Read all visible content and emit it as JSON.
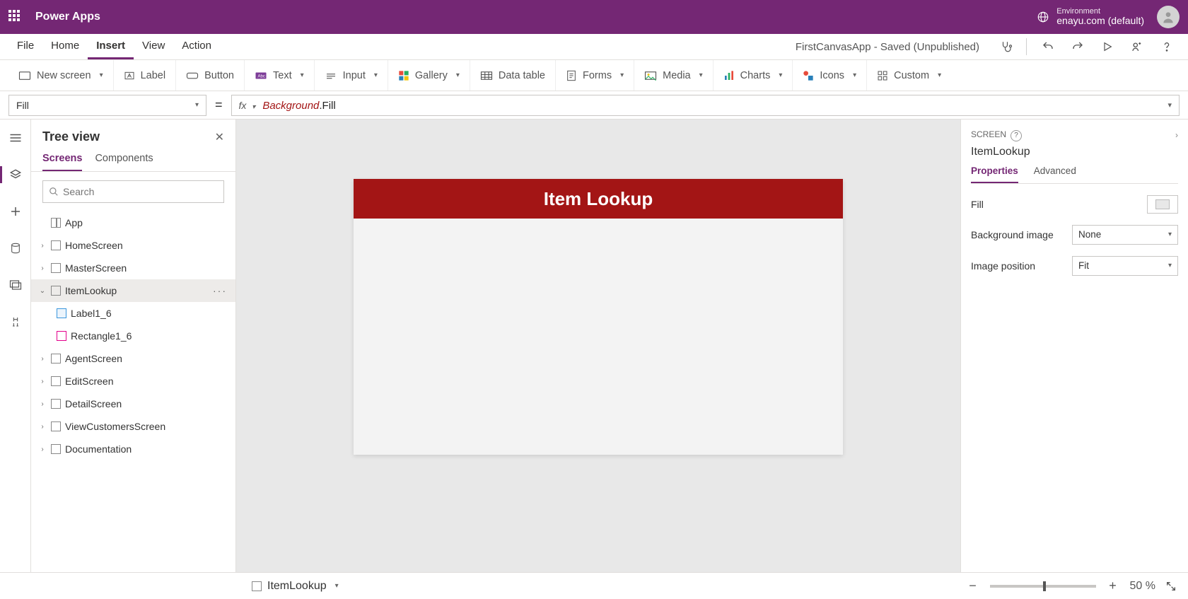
{
  "header": {
    "app_title": "Power Apps",
    "env_label": "Environment",
    "env_name": "enayu.com (default)"
  },
  "menu": {
    "items": [
      "File",
      "Home",
      "Insert",
      "View",
      "Action"
    ],
    "active_index": 2,
    "doc_status": "FirstCanvasApp - Saved (Unpublished)"
  },
  "ribbon": {
    "new_screen": "New screen",
    "label": "Label",
    "button": "Button",
    "text": "Text",
    "input": "Input",
    "gallery": "Gallery",
    "data_table": "Data table",
    "forms": "Forms",
    "media": "Media",
    "charts": "Charts",
    "icons": "Icons",
    "custom": "Custom"
  },
  "formula": {
    "property": "Fill",
    "fx": "fx",
    "value_token1": "Background",
    "value_token2": ".Fill"
  },
  "tree": {
    "title": "Tree view",
    "tabs": [
      "Screens",
      "Components"
    ],
    "active_tab": 0,
    "search_placeholder": "Search",
    "app_label": "App",
    "items": [
      {
        "label": "HomeScreen"
      },
      {
        "label": "MasterScreen"
      },
      {
        "label": "ItemLookup",
        "selected": true,
        "expanded": true,
        "children": [
          {
            "label": "Label1_6",
            "type": "label"
          },
          {
            "label": "Rectangle1_6",
            "type": "rect"
          }
        ]
      },
      {
        "label": "AgentScreen"
      },
      {
        "label": "EditScreen"
      },
      {
        "label": "DetailScreen"
      },
      {
        "label": "ViewCustomersScreen"
      },
      {
        "label": "Documentation"
      }
    ]
  },
  "canvas": {
    "banner_text": "Item Lookup"
  },
  "props": {
    "section": "SCREEN",
    "name": "ItemLookup",
    "tabs": [
      "Properties",
      "Advanced"
    ],
    "active_tab": 0,
    "fill_label": "Fill",
    "bg_image_label": "Background image",
    "bg_image_value": "None",
    "img_pos_label": "Image position",
    "img_pos_value": "Fit"
  },
  "status": {
    "breadcrumb": "ItemLookup",
    "zoom_value": "50",
    "zoom_pct": "%"
  }
}
